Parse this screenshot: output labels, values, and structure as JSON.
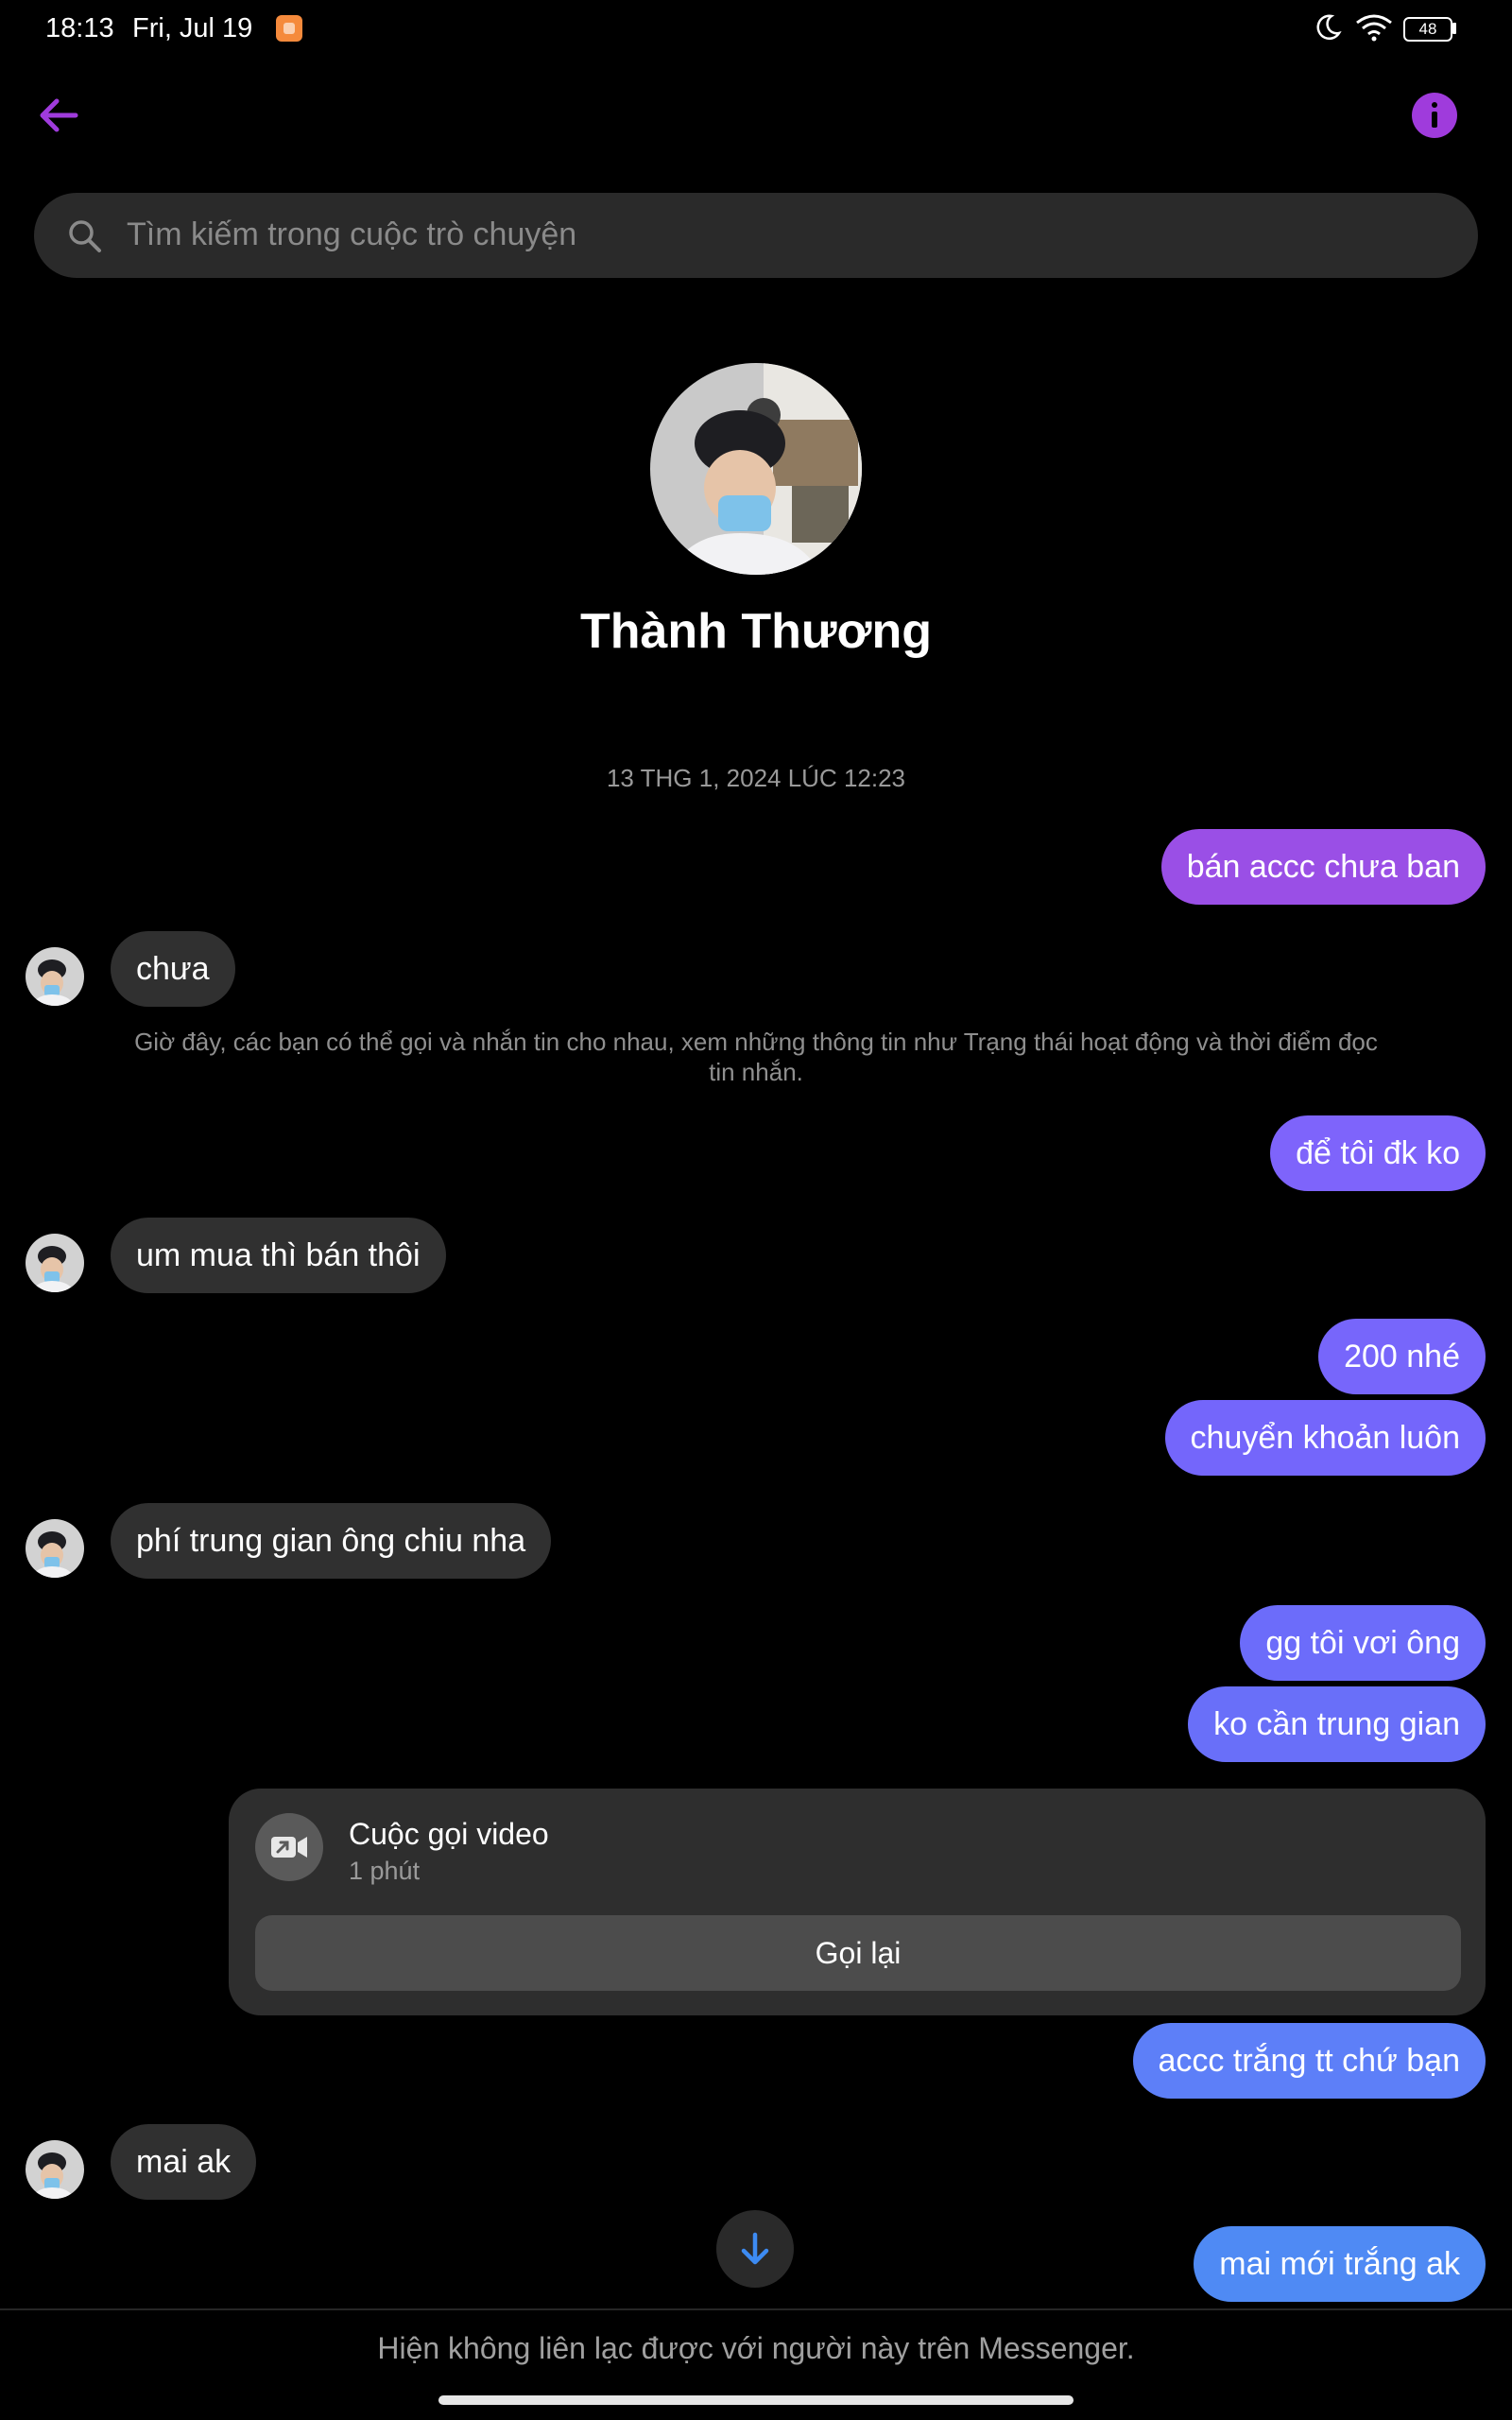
{
  "status_bar": {
    "time": "18:13",
    "date": "Fri, Jul 19",
    "battery": "48",
    "icons": [
      "app-notification-icon",
      "moon-icon",
      "wifi-icon",
      "battery-icon"
    ]
  },
  "header": {
    "back_icon": "back-arrow-icon",
    "info_icon": "info-icon",
    "accent_color": "#9f3bdc"
  },
  "search": {
    "placeholder": "Tìm kiếm trong cuộc trò chuyện",
    "value": ""
  },
  "profile": {
    "name": "Thành Thương"
  },
  "conversation": {
    "timestamp": "13 THG 1, 2024 LÚC 12:23",
    "system_note": "Giờ đây, các bạn có thể gọi và nhắn tin cho nhau, xem những thông tin như Trạng thái hoạt động và thời điểm đọc tin nhắn.",
    "messages": [
      {
        "direction": "out",
        "text": "bán accc chưa ban"
      },
      {
        "direction": "in",
        "text": "chưa"
      },
      {
        "direction": "out",
        "text": "để tôi đk ko"
      },
      {
        "direction": "in",
        "text": "um mua thì bán thôi"
      },
      {
        "direction": "out",
        "text": "200 nhé"
      },
      {
        "direction": "out",
        "text": "chuyển khoản luôn"
      },
      {
        "direction": "in",
        "text": "phí trung gian ông chiu nha"
      },
      {
        "direction": "out",
        "text": "gg tôi vơi ông"
      },
      {
        "direction": "out",
        "text": "ko cần trung gian"
      },
      {
        "direction": "out",
        "text": "accc trắng tt chứ bạn"
      },
      {
        "direction": "in",
        "text": "mai ak"
      },
      {
        "direction": "out",
        "text": "mai mới trắng ak"
      }
    ],
    "call": {
      "title": "Cuộc gọi video",
      "duration": "1 phút",
      "button_label": "Gọi lại",
      "icon": "video-call-icon"
    },
    "colors": {
      "outgoing_top": "#9a4fe6",
      "outgoing_bottom": "#3d8bf2",
      "incoming": "#303030"
    }
  },
  "footer": {
    "notice": "Hiện không liên lạc được với người này trên Messenger.",
    "scroll_icon": "arrow-down-icon"
  }
}
